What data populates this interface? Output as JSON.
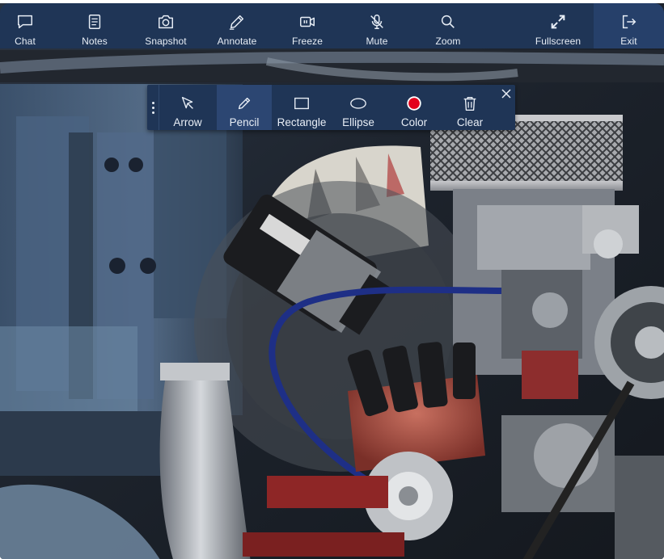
{
  "toolbar": {
    "items": [
      {
        "key": "chat",
        "label": "Chat",
        "icon": "chat-icon"
      },
      {
        "key": "notes",
        "label": "Notes",
        "icon": "notes-icon"
      },
      {
        "key": "snapshot",
        "label": "Snapshot",
        "icon": "camera-icon"
      },
      {
        "key": "annotate",
        "label": "Annotate",
        "icon": "pen-icon"
      },
      {
        "key": "freeze",
        "label": "Freeze",
        "icon": "freeze-icon"
      },
      {
        "key": "mute",
        "label": "Mute",
        "icon": "microphone-off-icon"
      },
      {
        "key": "zoom",
        "label": "Zoom",
        "icon": "magnifier-icon"
      },
      {
        "key": "fullscreen",
        "label": "Fullscreen",
        "icon": "expand-icon"
      },
      {
        "key": "exit",
        "label": "Exit",
        "icon": "exit-icon"
      }
    ]
  },
  "annotation": {
    "active_tool": "Pencil",
    "color_value": "#e3001b",
    "tools": [
      {
        "key": "arrow",
        "label": "Arrow",
        "icon": "cursor-arrow-icon"
      },
      {
        "key": "pencil",
        "label": "Pencil",
        "icon": "pencil-icon"
      },
      {
        "key": "rectangle",
        "label": "Rectangle",
        "icon": "rectangle-icon"
      },
      {
        "key": "ellipse",
        "label": "Ellipse",
        "icon": "ellipse-icon"
      },
      {
        "key": "color",
        "label": "Color",
        "icon": "color-swatch-icon"
      },
      {
        "key": "clear",
        "label": "Clear",
        "icon": "trash-icon"
      }
    ]
  },
  "colors": {
    "toolbar_bg": "#1f3556",
    "active_bg": "#2c4672",
    "icon_fg": "#e8eef6"
  }
}
